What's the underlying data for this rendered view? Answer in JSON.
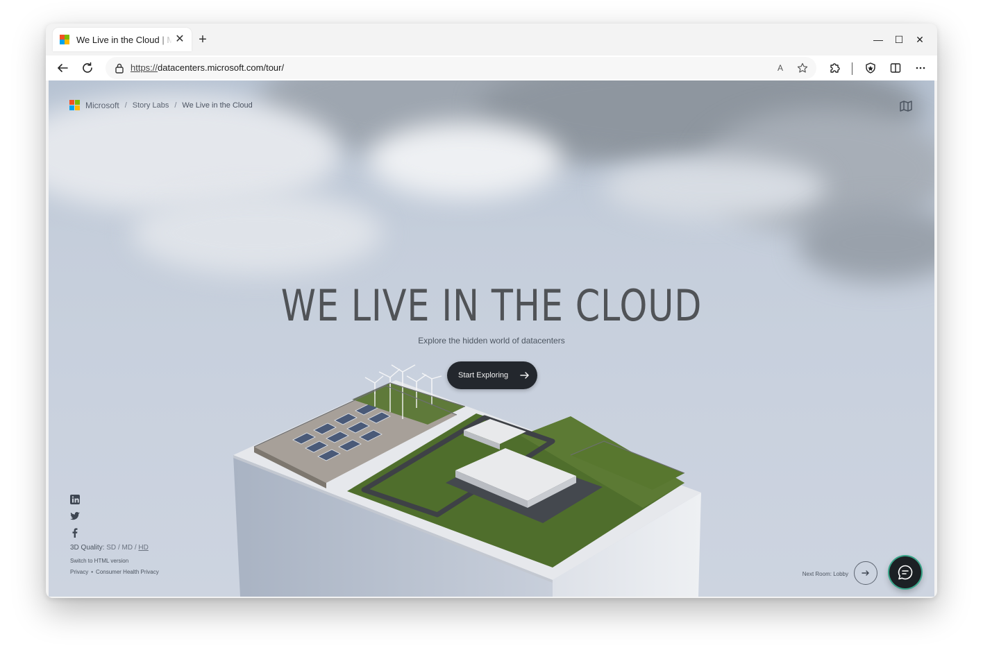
{
  "browser": {
    "tab_title": "We Live in the Cloud | Microsoft",
    "new_tab_label": "+",
    "close_tab_label": "✕",
    "window_controls": {
      "minimize": "—",
      "maximize": "☐",
      "close": "✕"
    },
    "url_protocol": "https://",
    "url_rest": "datacenters.microsoft.com/tour/",
    "read_aloud_label": "A"
  },
  "page": {
    "breadcrumb": {
      "brand": "Microsoft",
      "items": [
        "Story Labs",
        "We Live in the Cloud"
      ],
      "separator": "/"
    },
    "hero": {
      "title": "WE LIVE IN THE CLOUD",
      "subtitle": "Explore the hidden world of datacenters",
      "cta_label": "Start Exploring"
    },
    "footer": {
      "social": [
        "linkedin-icon",
        "twitter-icon",
        "facebook-icon"
      ],
      "quality_label": "3D Quality:",
      "quality_options": [
        "SD",
        "MD",
        "HD"
      ],
      "quality_sep": "/",
      "html_version": "Switch to HTML version",
      "privacy": "Privacy",
      "bullet": "•",
      "consumer_privacy": "Consumer Health Privacy",
      "next_room": "Next Room: Lobby"
    }
  },
  "colors": {
    "ms_red": "#f25022",
    "ms_green": "#7fba00",
    "ms_blue": "#00a4ef",
    "ms_yellow": "#ffb900",
    "cta_bg": "#23272d",
    "chat_ring": "#3aa58a"
  }
}
